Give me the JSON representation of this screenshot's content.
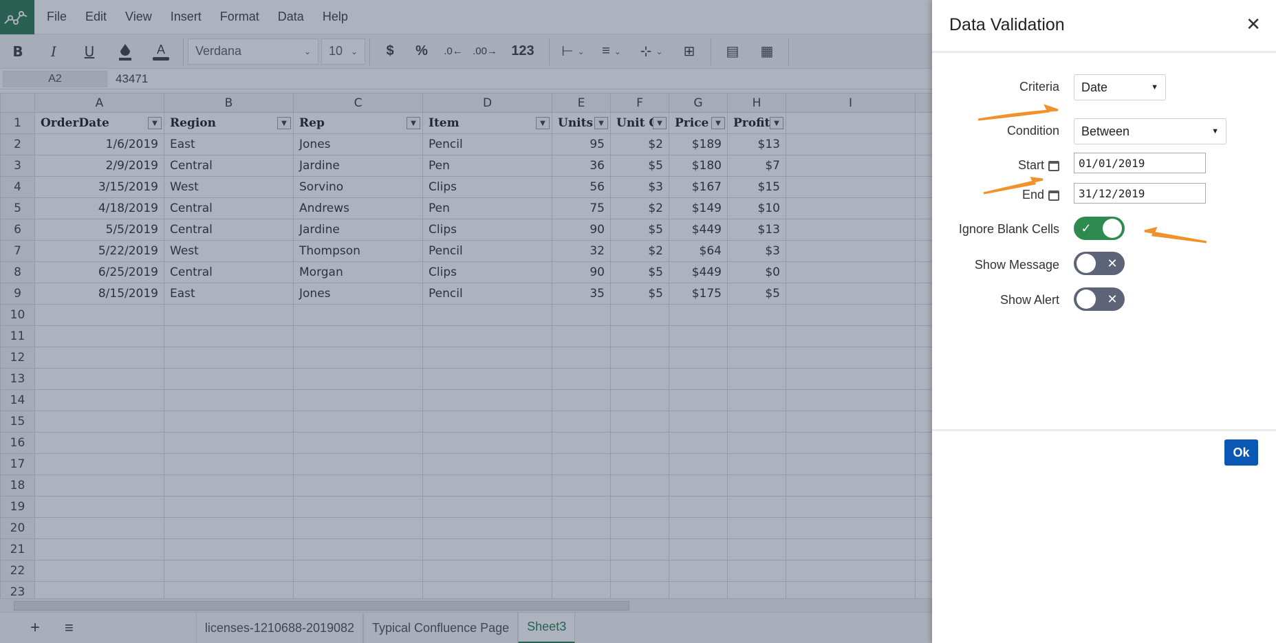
{
  "menubar": {
    "items": [
      "File",
      "Edit",
      "View",
      "Insert",
      "Format",
      "Data",
      "Help"
    ]
  },
  "toolbar": {
    "bold": "B",
    "italic": "I",
    "underline": "U",
    "text_color": "A",
    "font": "Verdana",
    "font_size": "10",
    "currency": "$",
    "percent": "%",
    "number_format": "123"
  },
  "formula_bar": {
    "cell_ref": "A2",
    "value": "43471"
  },
  "sheet": {
    "columns": [
      "A",
      "B",
      "C",
      "D",
      "E",
      "F",
      "G",
      "H",
      "I"
    ],
    "header_row": [
      "OrderDate",
      "Region",
      "Rep",
      "Item",
      "Units",
      "Unit C",
      "Price",
      "Profits"
    ],
    "rows": [
      [
        "1/6/2019",
        "East",
        "Jones",
        "Pencil",
        "95",
        "$2",
        "$189",
        "$13"
      ],
      [
        "2/9/2019",
        "Central",
        "Jardine",
        "Pen",
        "36",
        "$5",
        "$180",
        "$7"
      ],
      [
        "3/15/2019",
        "West",
        "Sorvino",
        "Clips",
        "56",
        "$3",
        "$167",
        "$15"
      ],
      [
        "4/18/2019",
        "Central",
        "Andrews",
        "Pen",
        "75",
        "$2",
        "$149",
        "$10"
      ],
      [
        "5/5/2019",
        "Central",
        "Jardine",
        "Clips",
        "90",
        "$5",
        "$449",
        "$13"
      ],
      [
        "5/22/2019",
        "West",
        "Thompson",
        "Pencil",
        "32",
        "$2",
        "$64",
        "$3"
      ],
      [
        "6/25/2019",
        "Central",
        "Morgan",
        "Clips",
        "90",
        "$5",
        "$449",
        "$0"
      ],
      [
        "8/15/2019",
        "East",
        "Jones",
        "Pencil",
        "35",
        "$5",
        "$175",
        "$5"
      ]
    ],
    "row_numbers": [
      "1",
      "2",
      "3",
      "4",
      "5",
      "6",
      "7",
      "8",
      "9",
      "10",
      "11",
      "12",
      "13",
      "14",
      "15",
      "16",
      "17",
      "18",
      "19",
      "20",
      "21",
      "22",
      "23"
    ]
  },
  "sheet_tabs": [
    "licenses-1210688-2019082",
    "Typical Confluence Page",
    "Sheet3"
  ],
  "active_tab": "Sheet3",
  "dialog": {
    "title": "Data Validation",
    "close": "✕",
    "criteria_label": "Criteria",
    "criteria_value": "Date",
    "condition_label": "Condition",
    "condition_value": "Between",
    "start_label": "Start",
    "start_value": "01/01/2019",
    "end_label": "End",
    "end_value": "31/12/2019",
    "ignore_blank_label": "Ignore Blank Cells",
    "ignore_blank_on": true,
    "show_message_label": "Show Message",
    "show_message_on": false,
    "show_alert_label": "Show Alert",
    "show_alert_on": false,
    "ok_label": "Ok"
  },
  "colors": {
    "brand_green": "#1e7145",
    "toggle_on": "#2e8b4f",
    "toggle_off": "#5d6478",
    "ok_button": "#0a57b5",
    "annotation_arrow": "#f0922b"
  }
}
